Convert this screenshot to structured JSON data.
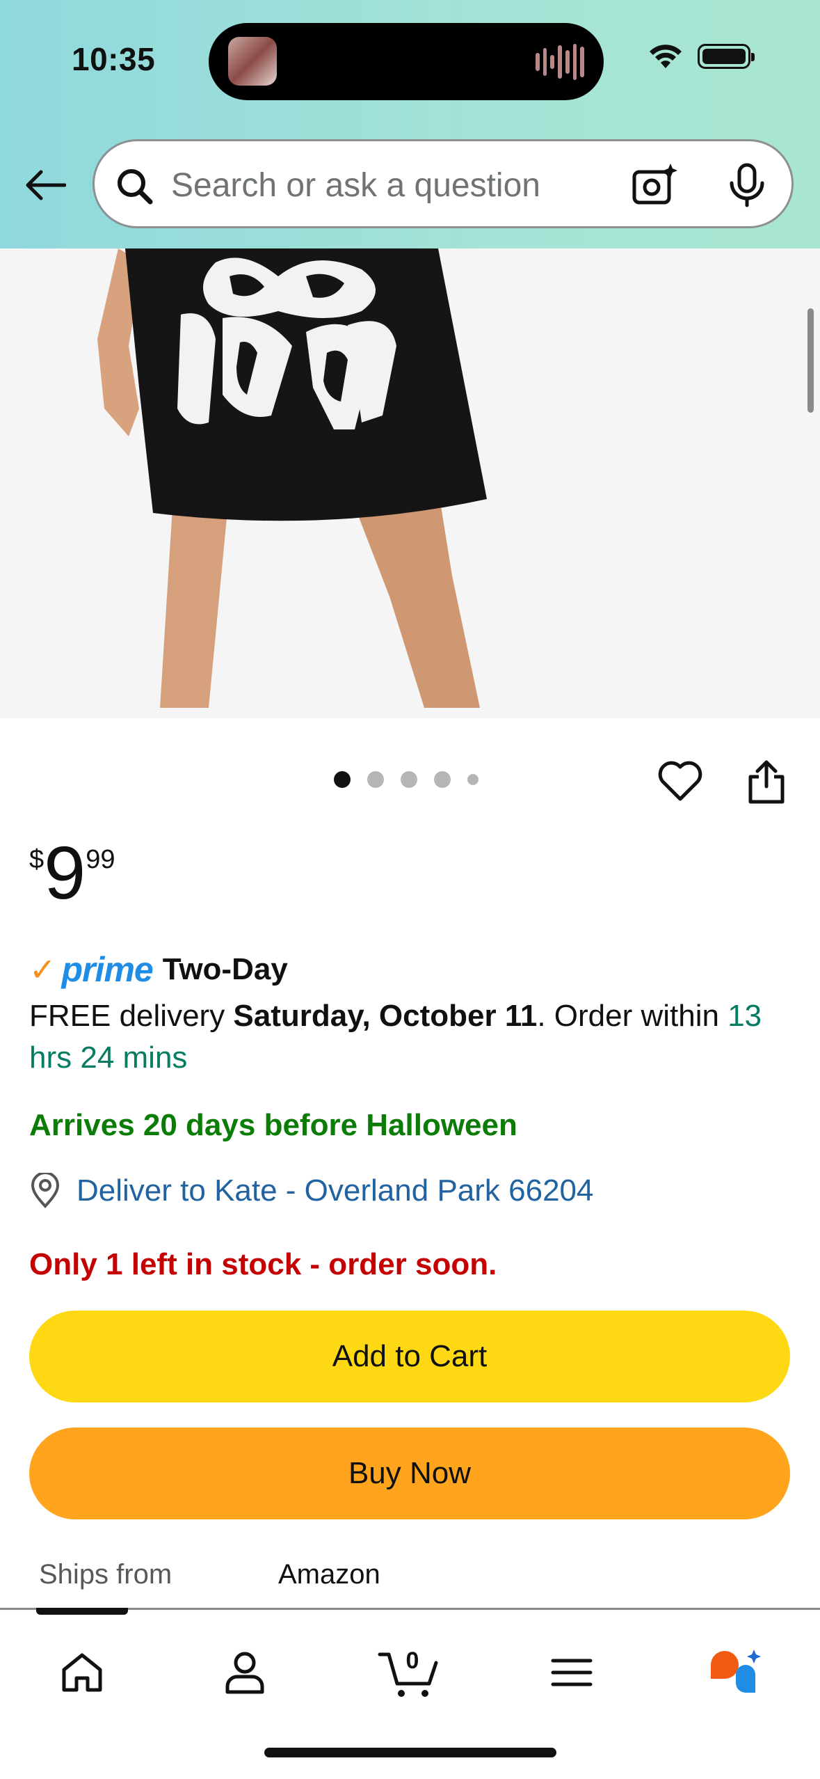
{
  "status_bar": {
    "time": "10:35"
  },
  "search": {
    "placeholder": "Search or ask a question"
  },
  "product": {
    "image_count": 5,
    "active_image": 1,
    "price": {
      "currency_symbol": "$",
      "whole": "9",
      "fraction": "99"
    },
    "prime": {
      "check": "✓",
      "word": "prime",
      "speed": "Two-Day"
    },
    "delivery": {
      "prefix": "FREE delivery ",
      "date": "Saturday, October 11",
      "middle": ". Order within ",
      "countdown": "13 hrs 24 mins"
    },
    "halloween_note": "Arrives 20 days before Halloween",
    "deliver_to": "Deliver to Kate - Overland Park 66204",
    "stock": "Only 1 left in stock - order soon.",
    "add_to_cart_label": "Add to Cart",
    "buy_now_label": "Buy Now",
    "ships_from_label": "Ships from",
    "ships_from_value": "Amazon"
  },
  "bottom_nav": {
    "cart_count": "0",
    "items": [
      "home-icon",
      "account-icon",
      "cart-icon",
      "menu-icon",
      "rufus-icon"
    ]
  },
  "colors": {
    "cart_button": "#ffd814",
    "buy_button": "#ffa41c",
    "prime_blue": "#1f8ce6",
    "prime_check": "#f7901e",
    "green_note": "#0b7d06",
    "stock_red": "#c40000",
    "link_blue": "#2162a1"
  }
}
